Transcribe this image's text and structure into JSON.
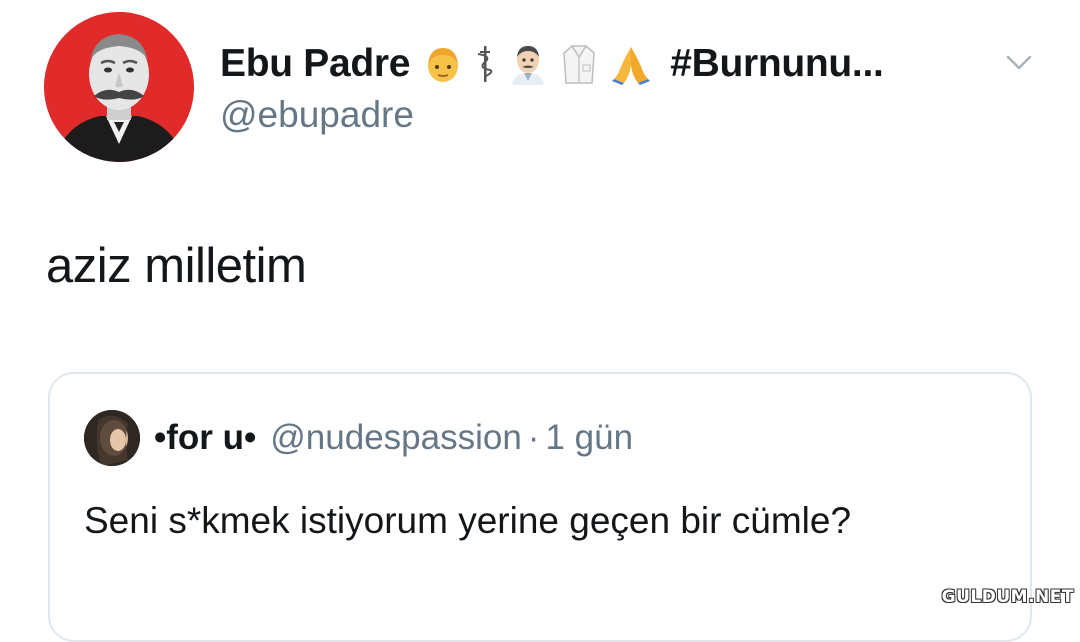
{
  "tweet": {
    "author": {
      "display_name": "Ebu Padre",
      "emojis": [
        "person-blond-emoji",
        "staff-of-aesculapius-emoji",
        "man-health-worker-emoji",
        "lab-coat-emoji",
        "folded-hands-emoji"
      ],
      "hashtag": "#Burnunu...",
      "handle": "@ebupadre"
    },
    "text": "aziz milletim",
    "quoted": {
      "display_name": "•for u•",
      "handle": "@nudespassion",
      "separator": "·",
      "time": "1 gün",
      "text": "Seni s*kmek istiyorum yerine geçen bir cümle?"
    }
  },
  "watermark": "GULDUM.NET",
  "colors": {
    "avatar_bg": "#e12a2a",
    "secondary_text": "#657786",
    "card_border": "#e1e8ed"
  }
}
